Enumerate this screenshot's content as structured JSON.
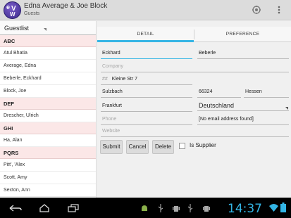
{
  "app": {
    "icon_text": "eVW",
    "title": "Edna Average & Joe Block",
    "subtitle": "Guests"
  },
  "actions": [
    {
      "name": "settings-ring-icon"
    },
    {
      "name": "overflow-menu-icon"
    }
  ],
  "guestlist": {
    "spinner_label": "Guestlist",
    "items": [
      {
        "type": "section",
        "label": "ABC"
      },
      {
        "type": "item",
        "label": "Atul Bhatia"
      },
      {
        "type": "item",
        "label": "Average, Edna"
      },
      {
        "type": "item",
        "label": "Beberle, Eckhard"
      },
      {
        "type": "item",
        "label": "Block, Joe"
      },
      {
        "type": "section",
        "label": "DEF"
      },
      {
        "type": "item",
        "label": "Drescher, Ulrich"
      },
      {
        "type": "section",
        "label": "GHI"
      },
      {
        "type": "item",
        "label": "Ha, Alan"
      },
      {
        "type": "section",
        "label": "PQRS"
      },
      {
        "type": "item",
        "label": "Pitt', 'Alex"
      },
      {
        "type": "item",
        "label": "Scott, Amy"
      },
      {
        "type": "item",
        "label": "Sexton, Ann"
      }
    ]
  },
  "tabs": {
    "detail": "DETAIL",
    "preference": "PREFERENCE"
  },
  "form": {
    "first_name": "Eckhard",
    "last_name": "Beberle",
    "company_placeholder": "Company",
    "house_no_placeholder": "##",
    "street": "Kleine Str 7",
    "city": "Sulzbach",
    "zip": "66324",
    "state": "Hessen",
    "district": "Frankfurt",
    "country": "Deutschland",
    "phone_placeholder": "Phone",
    "email": "[No email address found]",
    "website_placeholder": "Website"
  },
  "buttons": {
    "submit": "Submit",
    "cancel": "Cancel",
    "delete": "Delete",
    "supplier_label": "Is Supplier"
  },
  "status": {
    "time": "14:37"
  },
  "colors": {
    "accent": "#35b5e5",
    "section_bg": "#fbe7e7"
  }
}
